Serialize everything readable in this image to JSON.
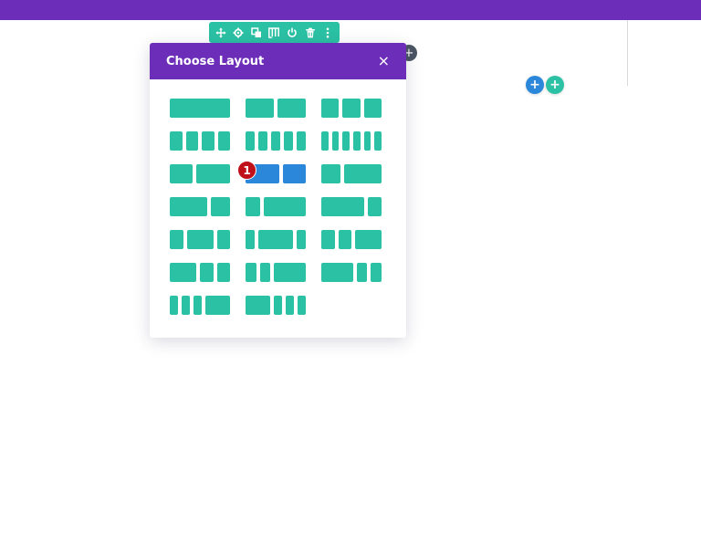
{
  "colors": {
    "primary": "#6c2eb9",
    "teal": "#2bc1a4",
    "blue": "#2b87da",
    "badge": "#c0101a"
  },
  "toolbar": {
    "icons": [
      "move-icon",
      "gear-icon",
      "duplicate-icon",
      "columns-icon",
      "power-icon",
      "trash-icon",
      "more-icon"
    ]
  },
  "modal": {
    "title": "Choose Layout",
    "close_label": "×"
  },
  "layouts": [
    [
      1
    ],
    [
      1,
      1
    ],
    [
      1,
      1,
      1
    ],
    [
      1,
      1,
      1,
      1
    ],
    [
      1,
      1,
      1,
      1,
      1
    ],
    [
      1,
      1,
      1,
      1,
      1,
      1
    ],
    [
      2,
      3
    ],
    [
      3,
      2
    ],
    [
      1,
      2
    ],
    [
      2,
      1
    ],
    [
      1,
      3
    ],
    [
      3,
      1
    ],
    [
      1,
      2,
      1
    ],
    [
      1,
      4,
      1
    ],
    [
      1,
      1,
      2
    ],
    [
      2,
      1,
      1
    ],
    [
      1,
      1,
      3
    ],
    [
      3,
      1,
      1
    ],
    [
      1,
      1,
      1,
      3
    ],
    [
      3,
      1,
      1,
      1
    ]
  ],
  "hovered_layout_index": 7,
  "step_badge": "1",
  "add_buttons": {
    "dark": "+",
    "blue": "+",
    "teal": "+"
  }
}
